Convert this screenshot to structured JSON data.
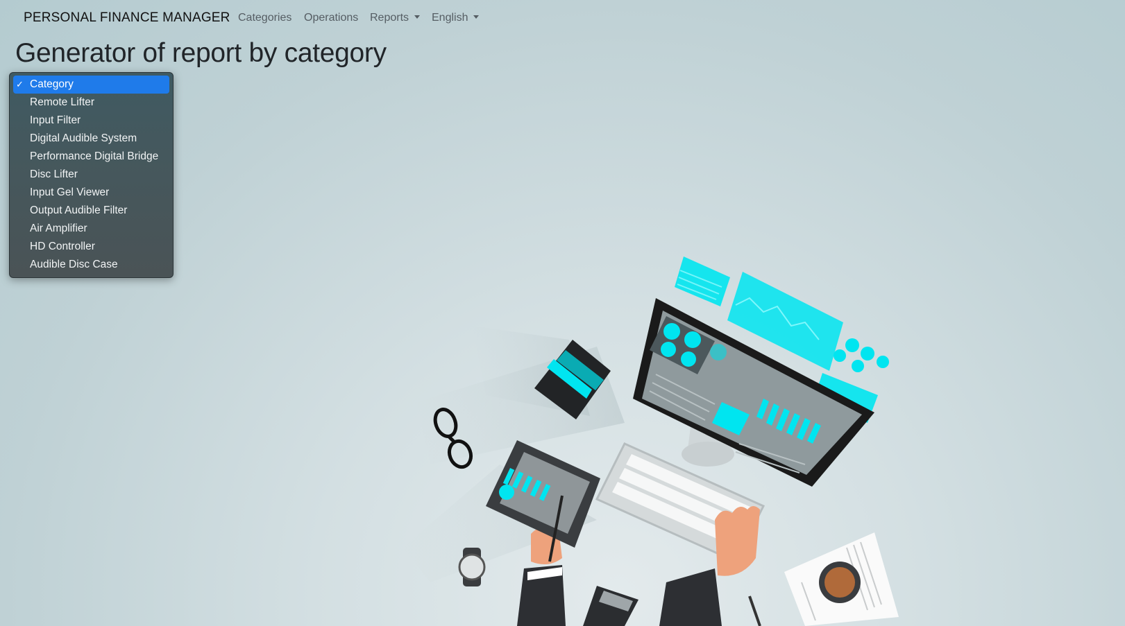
{
  "navbar": {
    "brand": "PERSONAL FINANCE MANAGER",
    "links": [
      "Categories",
      "Operations",
      "Reports",
      "English"
    ]
  },
  "page": {
    "title": "Generator of report by category"
  },
  "category_select": {
    "selected": "Category",
    "options": [
      "Category",
      "Remote Lifter",
      "Input Filter",
      "Digital Audible System",
      "Performance Digital Bridge",
      "Disc Lifter",
      "Input Gel Viewer",
      "Output Audible Filter",
      "Air Amplifier",
      "HD Controller",
      "Audible Disc Case"
    ]
  },
  "colors": {
    "accent": "#1f7bea",
    "illustration_cyan": "#00e5f0"
  }
}
